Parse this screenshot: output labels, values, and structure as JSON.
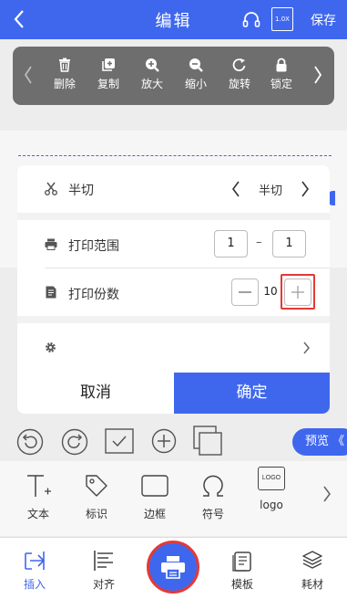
{
  "header": {
    "title": "编辑",
    "speed_label": "1.0X",
    "save_label": "保存"
  },
  "toolbar": {
    "items": [
      {
        "label": "删除",
        "icon": "trash-icon"
      },
      {
        "label": "复制",
        "icon": "copy-icon"
      },
      {
        "label": "放大",
        "icon": "zoom-in-icon"
      },
      {
        "label": "缩小",
        "icon": "zoom-out-icon"
      },
      {
        "label": "旋转",
        "icon": "rotate-icon"
      },
      {
        "label": "锁定",
        "icon": "lock-icon"
      }
    ]
  },
  "dialog": {
    "cut": {
      "label": "半切",
      "value": "半切"
    },
    "range": {
      "label": "打印范围",
      "from": "1",
      "to": "1",
      "separator": "–"
    },
    "copies": {
      "label": "打印份数",
      "value": "10"
    },
    "cancel_label": "取消",
    "confirm_label": "确定"
  },
  "preview_label": "预览 《",
  "panel": {
    "items": [
      {
        "label": "文本",
        "icon": "text-icon"
      },
      {
        "label": "标识",
        "icon": "tag-icon"
      },
      {
        "label": "边框",
        "icon": "border-icon"
      },
      {
        "label": "符号",
        "icon": "symbol-icon"
      },
      {
        "label": "logo",
        "icon": "logo-icon",
        "icon_text": "LOGO"
      }
    ]
  },
  "nav": {
    "items": [
      {
        "label": "插入",
        "icon": "insert-icon",
        "active": true
      },
      {
        "label": "对齐",
        "icon": "align-icon"
      },
      {
        "label": "",
        "icon": "print-icon"
      },
      {
        "label": "模板",
        "icon": "template-icon"
      },
      {
        "label": "耗材",
        "icon": "consumable-icon"
      }
    ]
  },
  "colors": {
    "accent": "#3f67ee",
    "highlight": "#e53935"
  }
}
